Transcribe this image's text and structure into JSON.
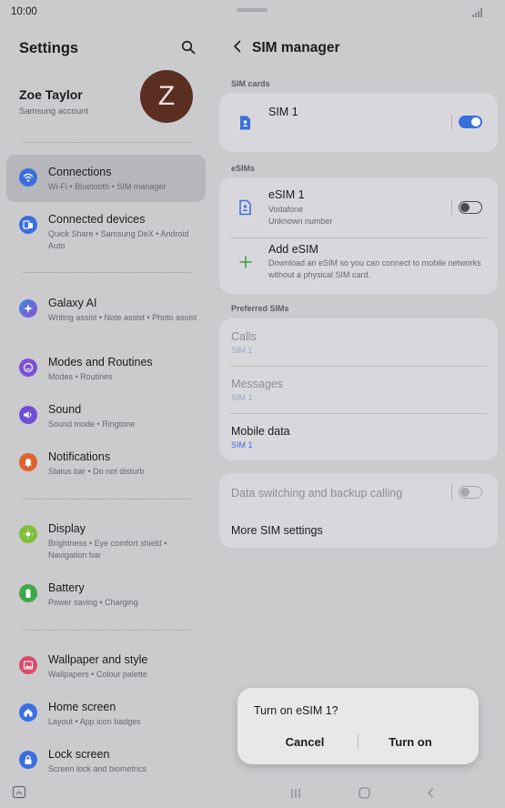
{
  "status_bar": {
    "time": "10:00"
  },
  "settings": {
    "title": "Settings",
    "profile": {
      "name": "Zoe Taylor",
      "account": "Samsung account",
      "initial": "Z"
    },
    "items": [
      {
        "label": "Connections",
        "sub": "Wi-Fi  •  Bluetooth  •  SIM manager",
        "icon": "wifi-icon",
        "color": "#3b6fe0"
      },
      {
        "label": "Connected devices",
        "sub": "Quick Share  •  Samsung DeX  •  Android Auto",
        "icon": "connected-devices-icon",
        "color": "#3b6fe0"
      },
      {
        "label": "Galaxy AI",
        "sub": "Writing assist  •  Note assist  •  Photo assist",
        "icon": "galaxy-ai-icon",
        "color": "#4a64d8"
      },
      {
        "label": "Modes and Routines",
        "sub": "Modes  •  Routines",
        "icon": "modes-icon",
        "color": "#7c52d8"
      },
      {
        "label": "Sound",
        "sub": "Sound mode  •  Ringtone",
        "icon": "sound-icon",
        "color": "#6f4fd6"
      },
      {
        "label": "Notifications",
        "sub": "Status bar  •  Do not disturb",
        "icon": "bell-icon",
        "color": "#e0622e"
      },
      {
        "label": "Display",
        "sub": "Brightness  •  Eye comfort shield  •  Navigation bar",
        "icon": "display-icon",
        "color": "#7fbf3a"
      },
      {
        "label": "Battery",
        "sub": "Power saving  •  Charging",
        "icon": "battery-icon",
        "color": "#3ea84a"
      },
      {
        "label": "Wallpaper and style",
        "sub": "Wallpapers  •  Colour palette",
        "icon": "wallpaper-icon",
        "color": "#d94d6a"
      },
      {
        "label": "Home screen",
        "sub": "Layout  •  App icon badges",
        "icon": "home-icon",
        "color": "#3b6fe0"
      },
      {
        "label": "Lock screen",
        "sub": "Screen lock and biometrics",
        "icon": "lock-icon",
        "color": "#3b6fe0"
      }
    ]
  },
  "sim_manager": {
    "title": "SIM manager",
    "sim_cards_header": "SIM cards",
    "sim1": {
      "name": "SIM 1",
      "enabled": true
    },
    "esims_header": "eSIMs",
    "esim1": {
      "name": "eSIM 1",
      "carrier": "Vodafone",
      "number": "Unknown number",
      "enabled": false
    },
    "add_esim": {
      "label": "Add eSIM",
      "desc": "Download an eSIM so you can connect to mobile networks without a physical SIM card."
    },
    "preferred_header": "Preferred SIMs",
    "preferred": [
      {
        "label": "Calls",
        "value": "SIM 1",
        "disabled": true
      },
      {
        "label": "Messages",
        "value": "SIM 1",
        "disabled": true
      },
      {
        "label": "Mobile data",
        "value": "SIM 1",
        "disabled": false
      }
    ],
    "data_switching": {
      "label": "Data switching and backup calling",
      "enabled": false
    },
    "more_settings": "More SIM settings"
  },
  "dialog": {
    "question": "Turn on eSIM 1?",
    "cancel": "Cancel",
    "confirm": "Turn on"
  },
  "colors": {
    "accent": "#3a6fdb",
    "background": "#cbcbce",
    "card": "#d8d8dc"
  }
}
